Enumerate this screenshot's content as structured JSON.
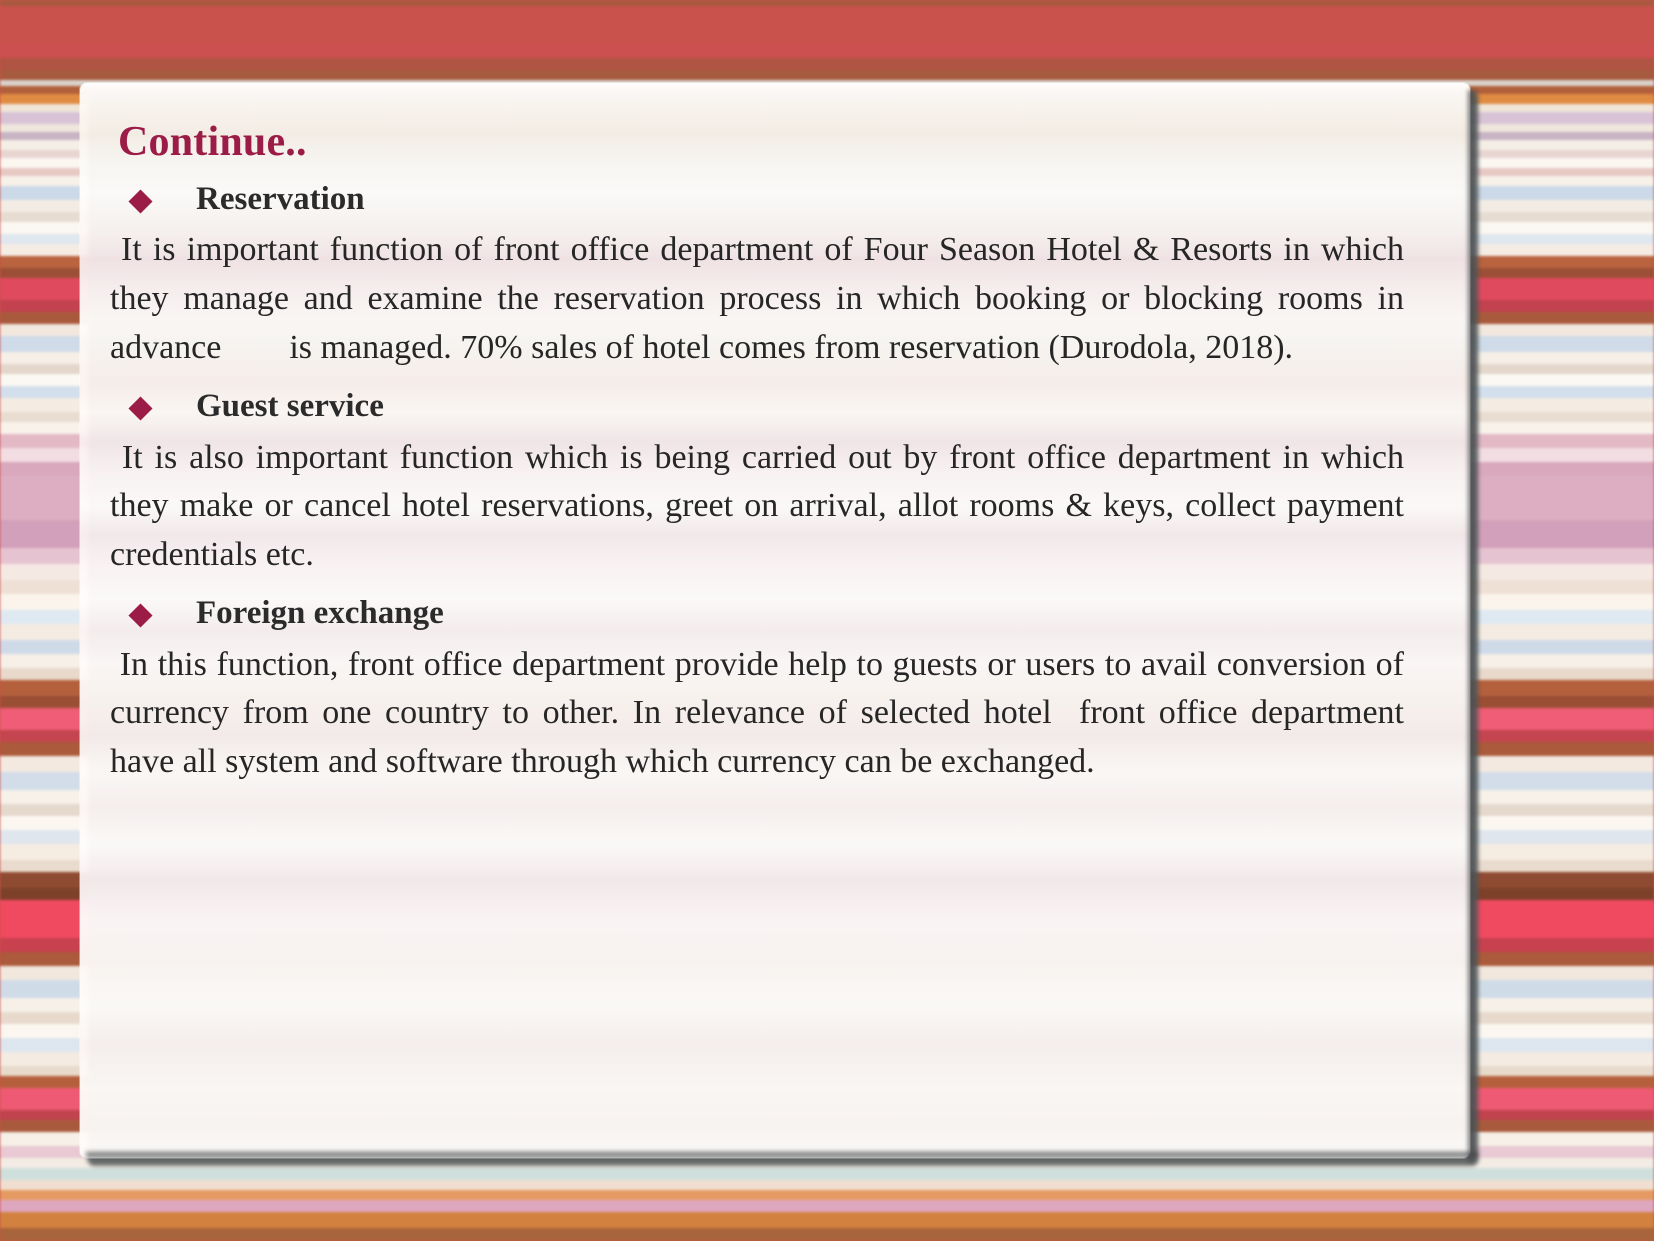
{
  "slide": {
    "title": "Continue..",
    "bullet_glyph": "diamond",
    "accent_color": "#9c1c48",
    "body_color": "#262626",
    "sections": [
      {
        "heading": "Reservation",
        "body": " It is important function of front office department of Four Season Hotel & Resorts in which they manage and examine the reservation process in which booking or blocking rooms in  advance        is managed. 70% sales of hotel comes from reservation (Durodola, 2018)."
      },
      {
        "heading": "Guest service",
        "body": " It is also important function which is being carried out by front office department in which they make or cancel hotel reservations, greet on arrival, allot rooms & keys, collect payment credentials etc."
      },
      {
        "heading": "Foreign exchange",
        "body": " In this function, front office department provide help to guests or users to avail conversion of currency from one country to other. In relevance of selected hotel  front office department have all system and software through which currency can be exchanged."
      }
    ]
  },
  "background": {
    "style": "horizontal-stripes",
    "top_band_color": "#c9524c",
    "bottom_band_color": "#a8643a"
  }
}
